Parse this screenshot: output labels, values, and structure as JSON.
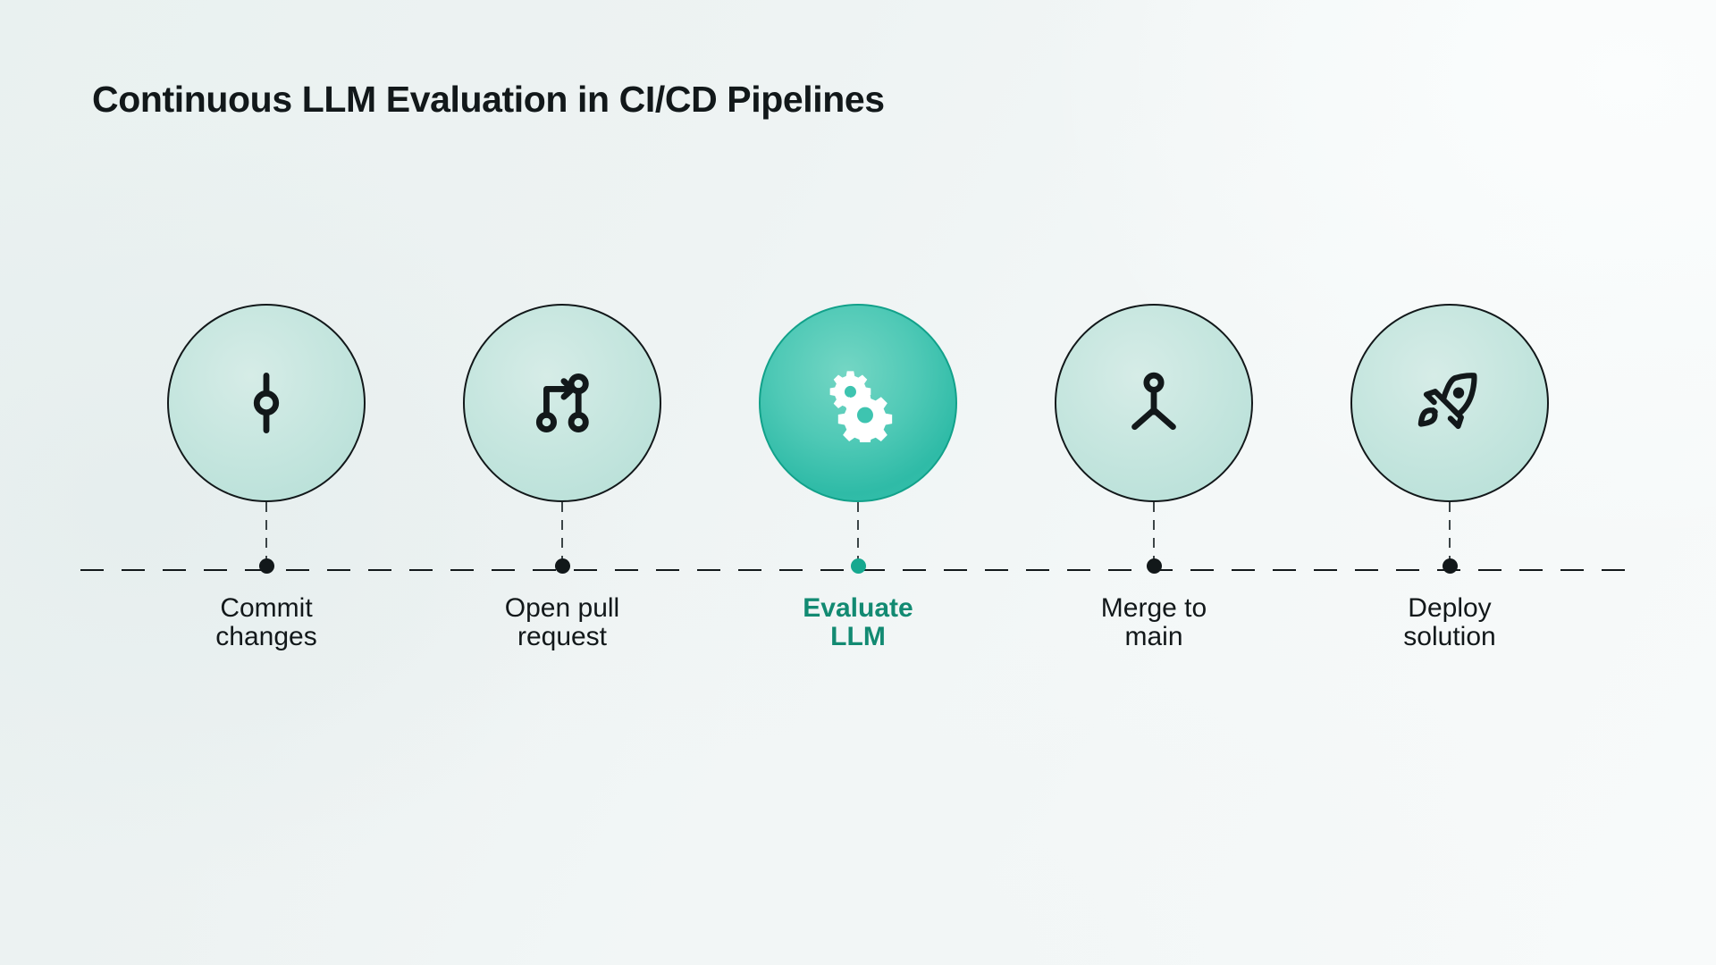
{
  "page": {
    "title": "Continuous LLM Evaluation in CI/CD Pipelines",
    "background_start": "#e9f1f0",
    "background_end": "#f8fafa"
  },
  "theme": {
    "text_color": "#12181a",
    "accent_color": "#128a72",
    "accent_fill": "#2fbba7",
    "bubble_fill": "#c6e6df",
    "node_color": "#12181a",
    "active_node_color": "#16a88f"
  },
  "timeline": {
    "axis_style": "dashed",
    "steps": [
      {
        "label": "Commit\nchanges",
        "icon": "git-commit-icon",
        "active": false
      },
      {
        "label": "Open pull\nrequest",
        "icon": "git-pull-request-icon",
        "active": false
      },
      {
        "label": "Evaluate\nLLM",
        "icon": "gears-icon",
        "active": true
      },
      {
        "label": "Merge to\nmain",
        "icon": "git-merge-icon",
        "active": false
      },
      {
        "label": "Deploy\nsolution",
        "icon": "rocket-icon",
        "active": false
      }
    ]
  }
}
